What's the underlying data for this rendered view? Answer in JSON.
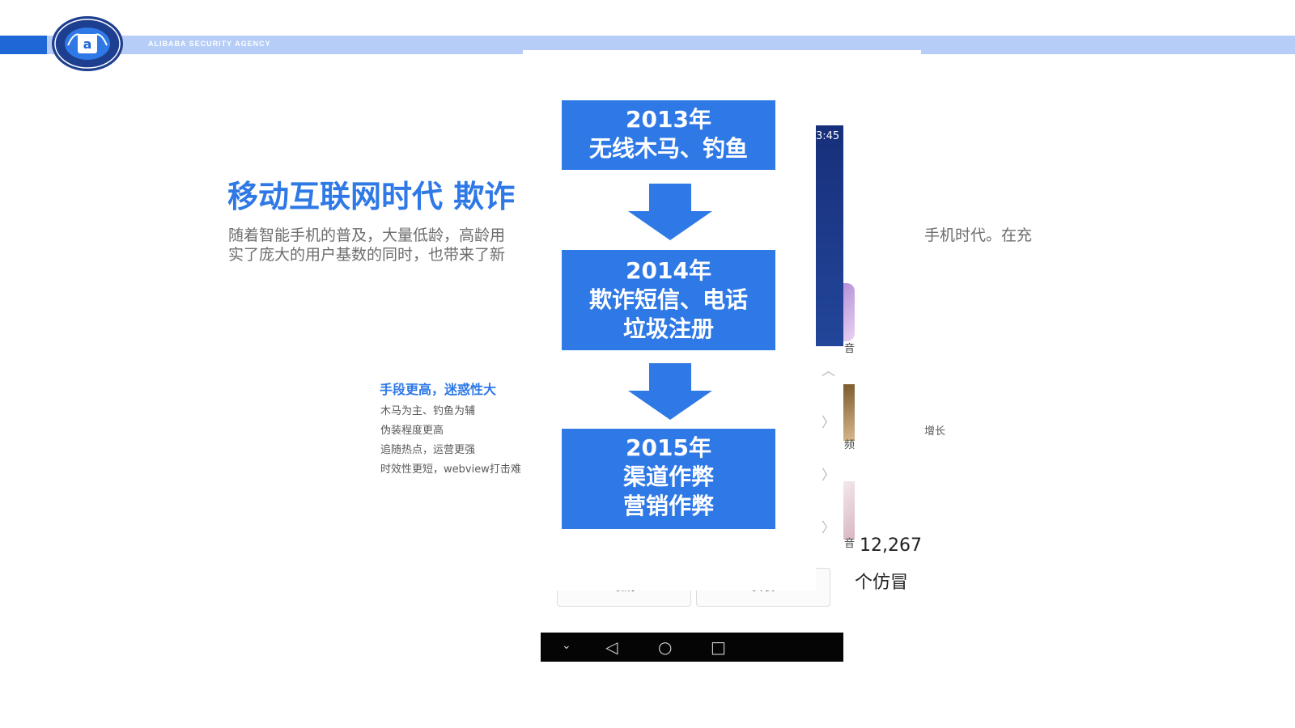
{
  "header": {
    "agency_text": "ALIBABA SECURITY AGENCY",
    "logo_name": "alibaba-security-seal",
    "brand_color": "#1f66d6",
    "band_color": "#b6cdf7"
  },
  "slide": {
    "title": "移动互联网时代 欺诈",
    "intro_line1": "随着智能手机的普及，大量低龄，高龄用",
    "intro_line2": "实了庞大的用户基数的同时，也带来了新",
    "intro_right": "手机时代。在充",
    "feature": {
      "heading": "手段更高，迷惑性大",
      "lines": [
        "木马为主、钓鱼为辅",
        "伪装程度更高",
        "追随热点，运营更强",
        "时效性更短，webview打击难"
      ]
    },
    "right_note": "增长",
    "accent_color": "#2f79e6"
  },
  "flow": {
    "steps": [
      {
        "year": "2013年",
        "lines": [
          "无线木马、钓鱼"
        ]
      },
      {
        "year": "2014年",
        "lines": [
          "欺诈短信、电话",
          "垃圾注册"
        ]
      },
      {
        "year": "2015年",
        "lines": [
          "渠道作弊",
          "营销作弊"
        ]
      }
    ]
  },
  "phone": {
    "time": "3:45",
    "cancel_label": "取消",
    "install_label": "安装",
    "count_text": "12,267",
    "fake_label": "个仿冒",
    "side_chars": [
      "音",
      "频",
      "音"
    ]
  }
}
